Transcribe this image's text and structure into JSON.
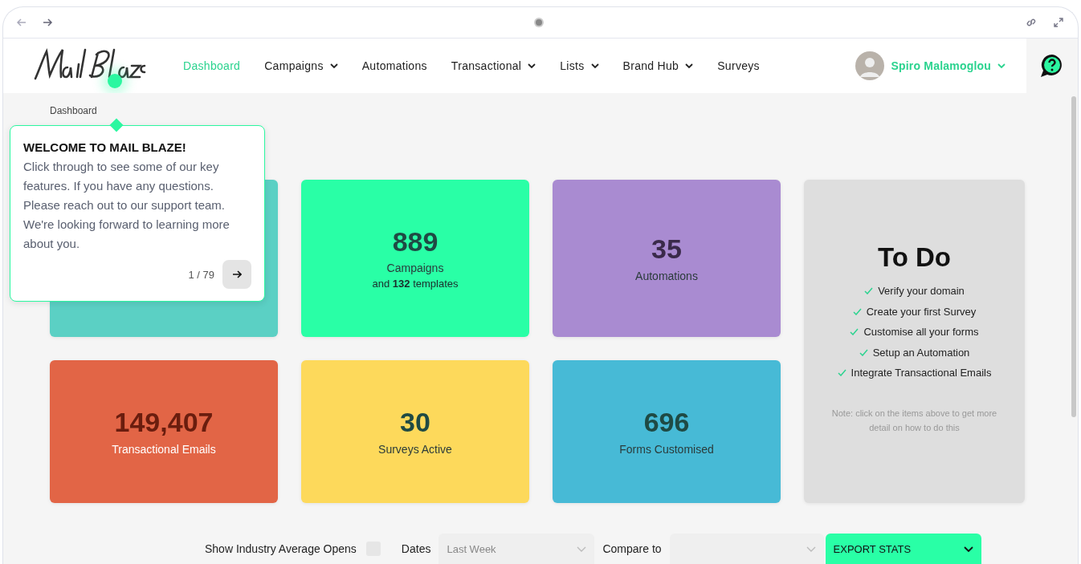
{
  "nav": {
    "items": [
      {
        "label": "Dashboard",
        "selected": true,
        "has_menu": false
      },
      {
        "label": "Campaigns",
        "selected": false,
        "has_menu": true
      },
      {
        "label": "Automations",
        "selected": false,
        "has_menu": false
      },
      {
        "label": "Transactional",
        "selected": false,
        "has_menu": true
      },
      {
        "label": "Lists",
        "selected": false,
        "has_menu": true
      },
      {
        "label": "Brand Hub",
        "selected": false,
        "has_menu": true
      },
      {
        "label": "Surveys",
        "selected": false,
        "has_menu": false
      }
    ],
    "user": "Spiro Malamoglou"
  },
  "breadcrumb": "Dashboard",
  "tour": {
    "title": "WELCOME TO MAIL BLAZE!",
    "body": "Click through to see some of our key features. If you have any questions. Please reach out to our support team. We're looking forward to learning more about you.",
    "pager": "1 / 79"
  },
  "cards": [
    {
      "color": "#5bd0c4"
    },
    {
      "color": "#29ffa6",
      "value": "889",
      "label": "Campaigns",
      "sub": "and **132** templates"
    },
    {
      "color": "#a98bd1",
      "value": "35",
      "label": "Automations"
    },
    {
      "color": "#e26546",
      "value": "149,407",
      "label": "Transactional Emails"
    },
    {
      "color": "#fdd95b",
      "value": "30",
      "label": "Surveys Active"
    },
    {
      "color": "#47bad6",
      "value": "696",
      "label": "Forms Customised"
    }
  ],
  "todo": {
    "title": "To Do",
    "items": [
      "Verify your domain",
      "Create your first Survey",
      "Customise all your forms",
      "Setup an Automation",
      "Integrate Transactional Emails"
    ],
    "note": "Note: click on the items above to get more detail on how to do this"
  },
  "filters": {
    "industry_label": "Show Industry Average Opens",
    "industry_checked": false,
    "dates_label": "Dates",
    "dates_value": "Last Week",
    "compare_label": "Compare to",
    "export": "EXPORT STATS"
  }
}
